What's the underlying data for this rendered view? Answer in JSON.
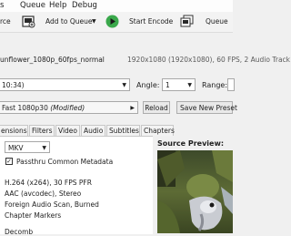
{
  "menu": [
    "s",
    "Queue",
    "Help",
    "Debug"
  ],
  "toolbar": {
    "source_label": "rce",
    "add_to_queue_label": "Add to Queue",
    "start_encode_label": "Start Encode",
    "queue_label": "Queue"
  },
  "source": {
    "title": "unflower_1080p_60fps_normal",
    "info": "1920x1080 (1920x1080), 60 FPS, 2 Audio Track"
  },
  "title_select": {
    "value": "10:34)",
    "angle_label": "Angle:",
    "angle_value": "1",
    "range_label": "Range:"
  },
  "preset": {
    "value": "Fast 1080p30",
    "modified": "(Modified)",
    "reload_label": "Reload",
    "save_label": "Save New Preset"
  },
  "tabs": [
    "ensions",
    "Filters",
    "Video",
    "Audio",
    "Subtitles",
    "Chapters"
  ],
  "summary": {
    "format_value": "MKV",
    "passthru_label": "Passthru Common Metadata",
    "passthru_checked": true,
    "lines": [
      "H.264 (x264), 30 FPS PFR",
      "AAC (avcodec), Stereo",
      "Foreign Audio Scan, Burned",
      "Chapter Markers"
    ],
    "bottom_line": "Decomb"
  },
  "preview": {
    "label": "Source Preview:"
  },
  "colors": {
    "accent": "#2b6cb0",
    "play_green": "#3aa84b"
  }
}
